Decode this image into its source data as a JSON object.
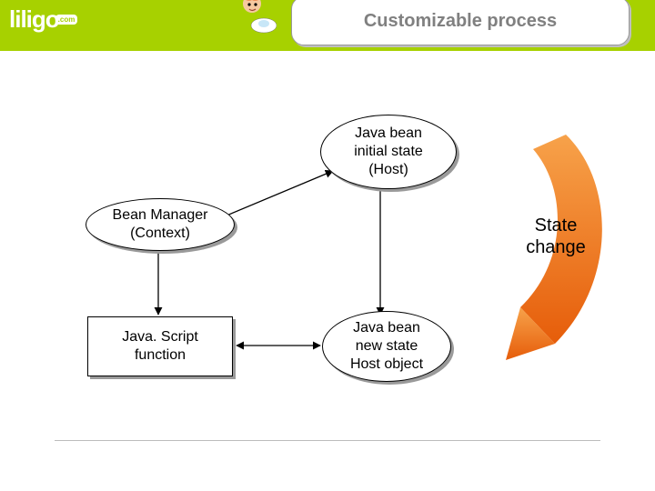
{
  "header": {
    "logo": "liligo",
    "logo_suffix": ".com",
    "title": "Customizable process"
  },
  "diagram": {
    "nodes": {
      "initial_state": "Java bean\ninitial state\n(Host)",
      "bean_manager": "Bean Manager\n(Context)",
      "js_function": "Java. Script\nfunction",
      "new_state": "Java bean\nnew state\nHost object"
    },
    "labels": {
      "state_change": "State\nchange"
    },
    "edges": [
      {
        "from": "bean_manager",
        "to": "initial_state",
        "bidirectional": false
      },
      {
        "from": "bean_manager",
        "to": "js_function",
        "bidirectional": false
      },
      {
        "from": "initial_state",
        "to": "new_state",
        "bidirectional": false
      },
      {
        "from": "js_function",
        "to": "new_state",
        "bidirectional": true
      }
    ],
    "big_arrow": {
      "meaning": "state_change",
      "color_top": "#f7a24a",
      "color_bottom": "#e65d0a"
    }
  },
  "colors": {
    "brand_green": "#a7d100",
    "title_grey": "#808080",
    "arrow_orange": "#ec6c10"
  }
}
